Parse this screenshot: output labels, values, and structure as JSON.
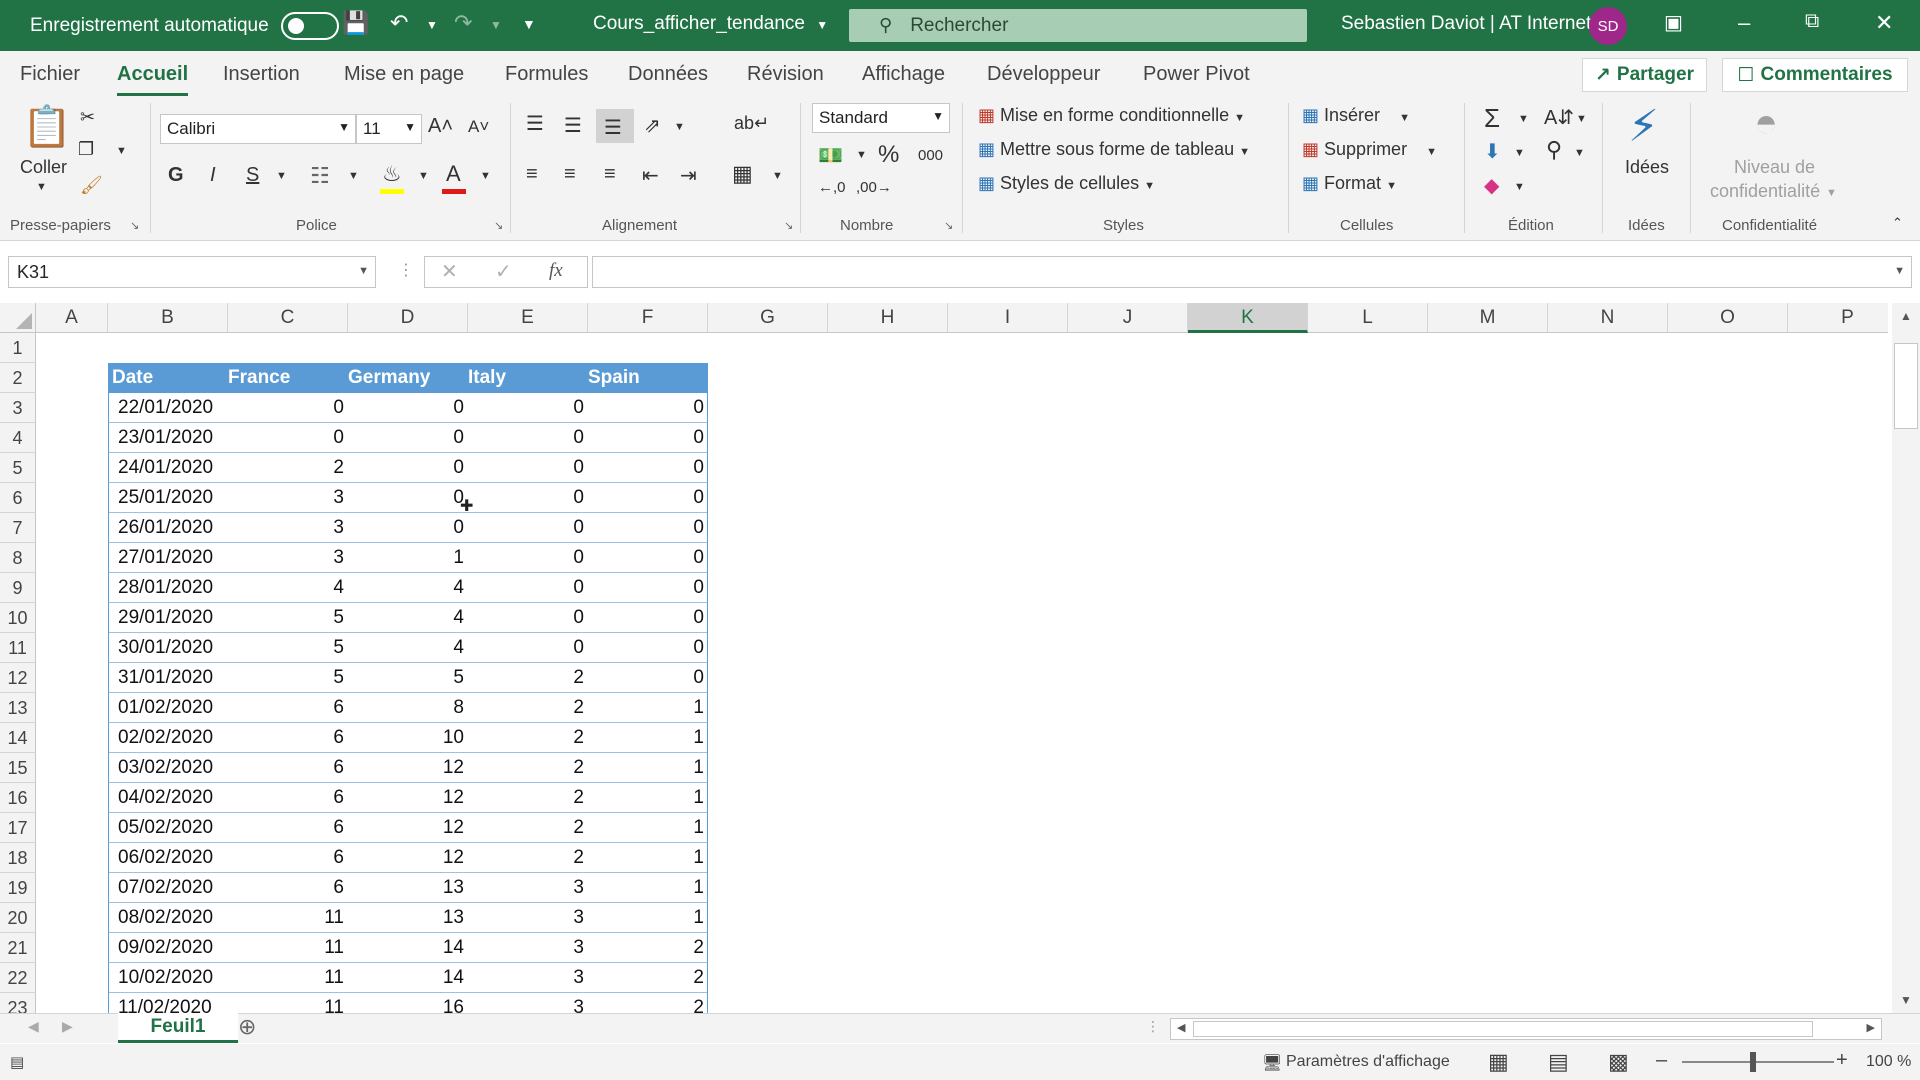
{
  "titlebar": {
    "autosave_label": "Enregistrement automatique",
    "document_title": "Cours_afficher_tendance",
    "search_placeholder": "Rechercher",
    "user_name": "Sebastien Daviot | AT Internet",
    "user_initials": "SD"
  },
  "menu": {
    "tabs": [
      "Fichier",
      "Accueil",
      "Insertion",
      "Mise en page",
      "Formules",
      "Données",
      "Révision",
      "Affichage",
      "Développeur",
      "Power Pivot"
    ],
    "active": "Accueil",
    "share_label": "Partager",
    "comments_label": "Commentaires"
  },
  "ribbon": {
    "clipboard": {
      "paste_label": "Coller",
      "group_label": "Presse-papiers"
    },
    "font": {
      "name": "Calibri",
      "size": "11",
      "bold": "G",
      "italic": "I",
      "underline": "S",
      "group_label": "Police"
    },
    "alignment": {
      "group_label": "Alignement"
    },
    "number": {
      "format": "Standard",
      "percent": "%",
      "thousands": "000",
      "group_label": "Nombre"
    },
    "styles": {
      "conditional": "Mise en forme conditionnelle",
      "as_table": "Mettre sous forme de tableau",
      "cell_styles": "Styles de cellules",
      "group_label": "Styles"
    },
    "cells": {
      "insert": "Insérer",
      "delete": "Supprimer",
      "format": "Format",
      "group_label": "Cellules"
    },
    "editing": {
      "group_label": "Édition"
    },
    "ideas": {
      "label": "Idées",
      "group_label": "Idées"
    },
    "sensitivity": {
      "label_line1": "Niveau de",
      "label_line2": "confidentialité",
      "group_label": "Confidentialité"
    }
  },
  "formula_bar": {
    "name_box": "K31",
    "fx": "fx",
    "formula": ""
  },
  "sheet": {
    "columns": [
      "A",
      "B",
      "C",
      "D",
      "E",
      "F",
      "G",
      "H",
      "I",
      "J",
      "K",
      "L",
      "M",
      "N",
      "O",
      "P"
    ],
    "selected_column": "K",
    "row_numbers": [
      "1",
      "2",
      "3",
      "4",
      "5",
      "6",
      "7",
      "8",
      "9",
      "10",
      "11",
      "12",
      "13",
      "14",
      "15",
      "16",
      "17",
      "18",
      "19",
      "20",
      "21",
      "22",
      "23"
    ],
    "table_headers": [
      "Date",
      "France",
      "Germany",
      "Italy",
      "Spain"
    ],
    "table_rows": [
      [
        "22/01/2020",
        "0",
        "0",
        "0",
        "0"
      ],
      [
        "23/01/2020",
        "0",
        "0",
        "0",
        "0"
      ],
      [
        "24/01/2020",
        "2",
        "0",
        "0",
        "0"
      ],
      [
        "25/01/2020",
        "3",
        "0",
        "0",
        "0"
      ],
      [
        "26/01/2020",
        "3",
        "0",
        "0",
        "0"
      ],
      [
        "27/01/2020",
        "3",
        "1",
        "0",
        "0"
      ],
      [
        "28/01/2020",
        "4",
        "4",
        "0",
        "0"
      ],
      [
        "29/01/2020",
        "5",
        "4",
        "0",
        "0"
      ],
      [
        "30/01/2020",
        "5",
        "4",
        "0",
        "0"
      ],
      [
        "31/01/2020",
        "5",
        "5",
        "2",
        "0"
      ],
      [
        "01/02/2020",
        "6",
        "8",
        "2",
        "1"
      ],
      [
        "02/02/2020",
        "6",
        "10",
        "2",
        "1"
      ],
      [
        "03/02/2020",
        "6",
        "12",
        "2",
        "1"
      ],
      [
        "04/02/2020",
        "6",
        "12",
        "2",
        "1"
      ],
      [
        "05/02/2020",
        "6",
        "12",
        "2",
        "1"
      ],
      [
        "06/02/2020",
        "6",
        "12",
        "2",
        "1"
      ],
      [
        "07/02/2020",
        "6",
        "13",
        "3",
        "1"
      ],
      [
        "08/02/2020",
        "11",
        "13",
        "3",
        "1"
      ],
      [
        "09/02/2020",
        "11",
        "14",
        "3",
        "2"
      ],
      [
        "10/02/2020",
        "11",
        "14",
        "3",
        "2"
      ],
      [
        "11/02/2020",
        "11",
        "16",
        "3",
        "2"
      ]
    ]
  },
  "sheet_tabs": {
    "active": "Feuil1"
  },
  "status": {
    "display_settings": "Paramètres d'affichage",
    "zoom": "100 %"
  },
  "colors": {
    "accent": "#217346",
    "table_header": "#5b9bd5",
    "table_border": "#9bc2e6"
  }
}
